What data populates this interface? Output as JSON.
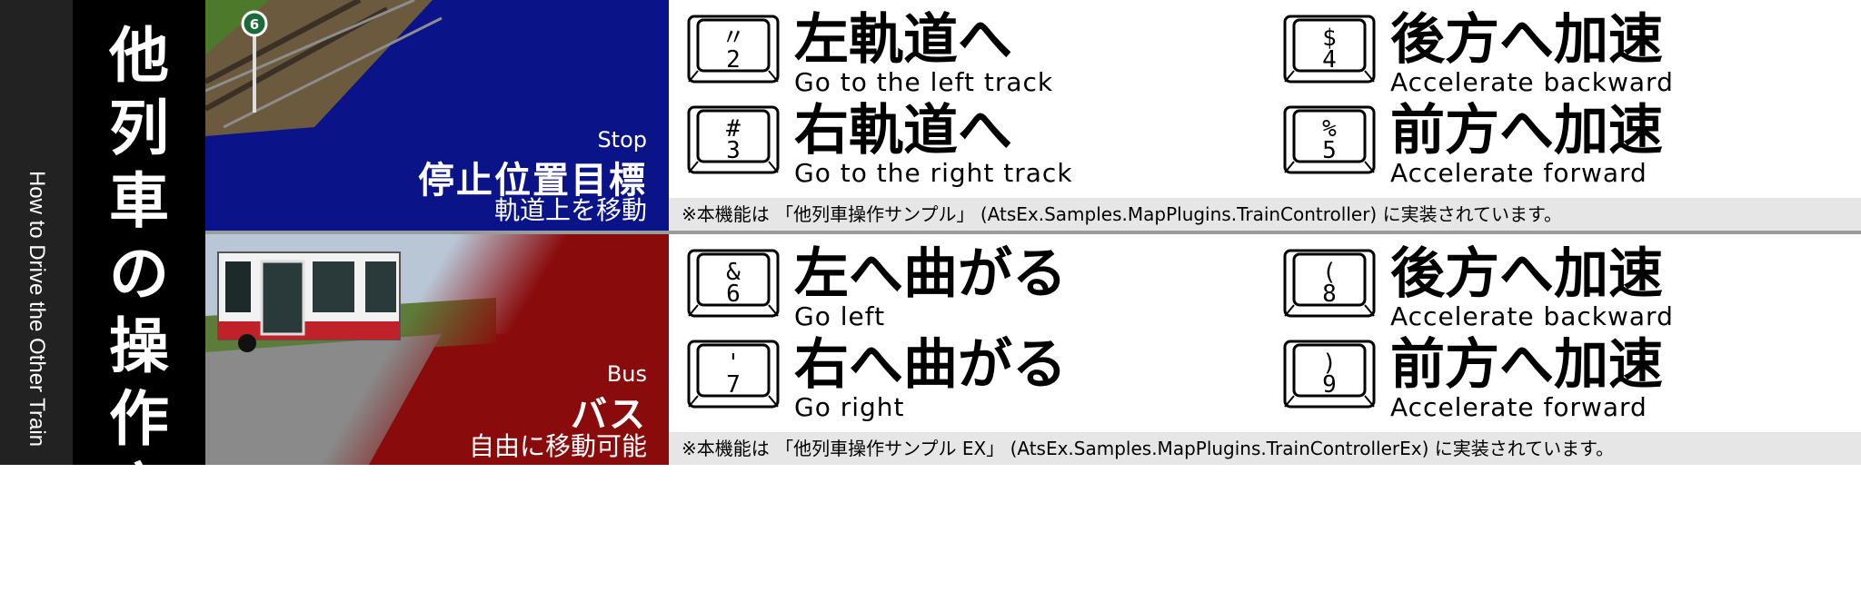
{
  "sidebar": {
    "subtitle": "How to Drive the Other Train"
  },
  "title": "他列車の操作方法",
  "sections": [
    {
      "label_en": "Stop",
      "title": "停止位置目標",
      "subtitle": "軌道上を移動",
      "sign_number": "6",
      "controls": [
        {
          "key_top": "〃",
          "key_bottom": "2",
          "jp": "左軌道へ",
          "en": "Go to the left track"
        },
        {
          "key_top": "$",
          "key_bottom": "4",
          "jp": "後方へ加速",
          "en": "Accelerate backward"
        },
        {
          "key_top": "#",
          "key_bottom": "3",
          "jp": "右軌道へ",
          "en": "Go to the right track"
        },
        {
          "key_top": "%",
          "key_bottom": "5",
          "jp": "前方へ加速",
          "en": "Accelerate forward"
        }
      ],
      "note": "※本機能は 「他列車操作サンプル」 (AtsEx.Samples.MapPlugins.TrainController) に実装されています。"
    },
    {
      "label_en": "Bus",
      "title": "バス",
      "subtitle": "自由に移動可能",
      "controls": [
        {
          "key_top": "&",
          "key_bottom": "6",
          "jp": "左へ曲がる",
          "en": "Go left"
        },
        {
          "key_top": "(",
          "key_bottom": "8",
          "jp": "後方へ加速",
          "en": "Accelerate backward"
        },
        {
          "key_top": "'",
          "key_bottom": "7",
          "jp": "右へ曲がる",
          "en": "Go right"
        },
        {
          "key_top": ")",
          "key_bottom": "9",
          "jp": "前方へ加速",
          "en": "Accelerate forward"
        }
      ],
      "note": "※本機能は 「他列車操作サンプル EX」 (AtsEx.Samples.MapPlugins.TrainControllerEx) に実装されています。"
    }
  ],
  "colors": {
    "blue_panel": "#0a1488",
    "red_panel": "#8a0b0b",
    "sidebar": "#222222",
    "note_bg": "#e6e6e6"
  },
  "icons": [
    "keyboard-key-icon",
    "distance-sign-icon",
    "railway-track-image",
    "bus-image"
  ]
}
